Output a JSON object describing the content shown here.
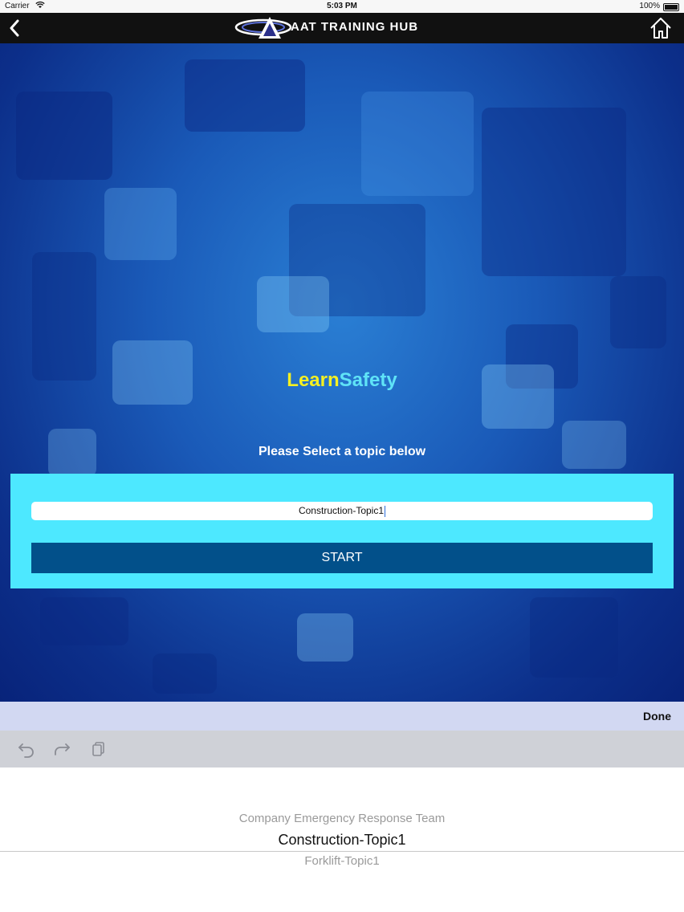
{
  "status_bar": {
    "carrier": "Carrier",
    "time": "5:03 PM",
    "battery": "100%"
  },
  "nav": {
    "logo_text": "AAT TRAINING HUB"
  },
  "main": {
    "title_part1": "Learn",
    "title_part2": "Safety",
    "subtitle": "Please Select a topic below",
    "topic_value": "Construction-Topic1",
    "start_label": "START"
  },
  "keyboard_bar": {
    "done_label": "Done"
  },
  "picker": {
    "options": [
      "Company Emergency Response Team",
      "Construction-Topic1",
      "Forklift-Topic1"
    ],
    "selected": "Construction-Topic1"
  },
  "colors": {
    "title_learn": "#f4f022",
    "title_safety": "#5fe3f7",
    "panel": "#4de8ff",
    "start_button": "#02508a"
  }
}
